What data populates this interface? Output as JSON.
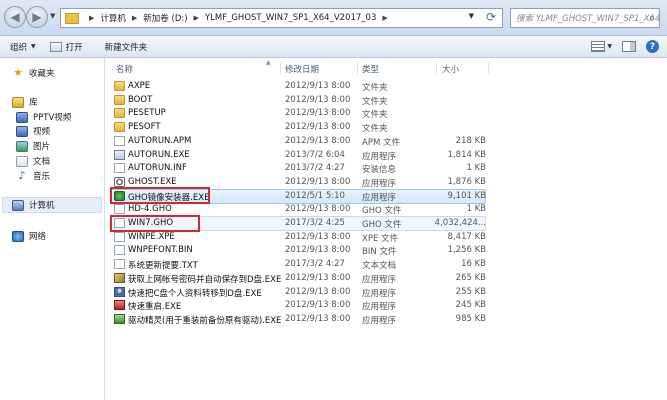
{
  "address": {
    "crumbs": [
      "计算机",
      "新加卷 (D:)",
      "YLMF_GHOST_WIN7_SP1_X64_V2017_03"
    ],
    "search_placeholder": "搜索 YLMF_GHOST_WIN7_SP1_X64_..."
  },
  "commandbar": {
    "organize": "组织",
    "open": "打开",
    "new_folder": "新建文件夹"
  },
  "navigation": {
    "favorites": "收藏夹",
    "library": "库",
    "pptv": "PPTV视频",
    "videos": "视频",
    "pictures": "图片",
    "documents": "文档",
    "music": "音乐",
    "computer": "计算机",
    "network": "网络"
  },
  "columns": {
    "name": "名称",
    "modified": "修改日期",
    "type": "类型",
    "size": "大小"
  },
  "files": [
    {
      "name": "AXPE",
      "date": "2012/9/13 8:00",
      "type": "文件夹",
      "size": "",
      "icon": "folder-icon"
    },
    {
      "name": "BOOT",
      "date": "2012/9/13 8:00",
      "type": "文件夹",
      "size": "",
      "icon": "folder-icon"
    },
    {
      "name": "PESETUP",
      "date": "2012/9/13 8:00",
      "type": "文件夹",
      "size": "",
      "icon": "folder-icon"
    },
    {
      "name": "PESOFT",
      "date": "2012/9/13 8:00",
      "type": "文件夹",
      "size": "",
      "icon": "folder-icon"
    },
    {
      "name": "AUTORUN.APM",
      "date": "2012/9/13 8:00",
      "type": "APM 文件",
      "size": "218 KB",
      "icon": "file-icon"
    },
    {
      "name": "AUTORUN.EXE",
      "date": "2013/7/2 6:04",
      "type": "应用程序",
      "size": "1,814 KB",
      "icon": "exe-icon"
    },
    {
      "name": "AUTORUN.INF",
      "date": "2013/7/2 4:27",
      "type": "安装信息",
      "size": "1 KB",
      "icon": "file-icon"
    },
    {
      "name": "GHOST.EXE",
      "date": "2012/9/13 8:00",
      "type": "应用程序",
      "size": "1,876 KB",
      "icon": "ghost-icon"
    },
    {
      "name": "GHO镜像安装器.EXE",
      "date": "2012/5/1 5:10",
      "type": "应用程序",
      "size": "9,101 KB",
      "icon": "gho-installer-icon"
    },
    {
      "name": "HD-4.GHO",
      "date": "2012/9/13 8:00",
      "type": "GHO 文件",
      "size": "1 KB",
      "icon": "file-icon"
    },
    {
      "name": "WIN7.GHO",
      "date": "2017/3/2 4:25",
      "type": "GHO 文件",
      "size": "4,032,424...",
      "icon": "file-icon"
    },
    {
      "name": "WINPE.XPE",
      "date": "2012/9/13 8:00",
      "type": "XPE 文件",
      "size": "8,417 KB",
      "icon": "file-icon"
    },
    {
      "name": "WNPEFONT.BIN",
      "date": "2012/9/13 8:00",
      "type": "BIN 文件",
      "size": "1,256 KB",
      "icon": "file-icon"
    },
    {
      "name": "系统更新提要.TXT",
      "date": "2017/3/2 4:27",
      "type": "文本文档",
      "size": "16 KB",
      "icon": "file-icon"
    },
    {
      "name": "获取上网帐号密码并自动保存到D盘.EXE",
      "date": "2012/9/13 8:00",
      "type": "应用程序",
      "size": "265 KB",
      "icon": "key-icon"
    },
    {
      "name": "快速把C盘个人资料转移到D盘.EXE",
      "date": "2012/9/13 8:00",
      "type": "应用程序",
      "size": "255 KB",
      "icon": "person-icon"
    },
    {
      "name": "快速重启.EXE",
      "date": "2012/9/13 8:00",
      "type": "应用程序",
      "size": "245 KB",
      "icon": "restart-icon"
    },
    {
      "name": "驱动精灵(用于重装前备份原有驱动).EXE",
      "date": "2012/9/13 8:00",
      "type": "应用程序",
      "size": "985 KB",
      "icon": "driver-icon"
    }
  ]
}
